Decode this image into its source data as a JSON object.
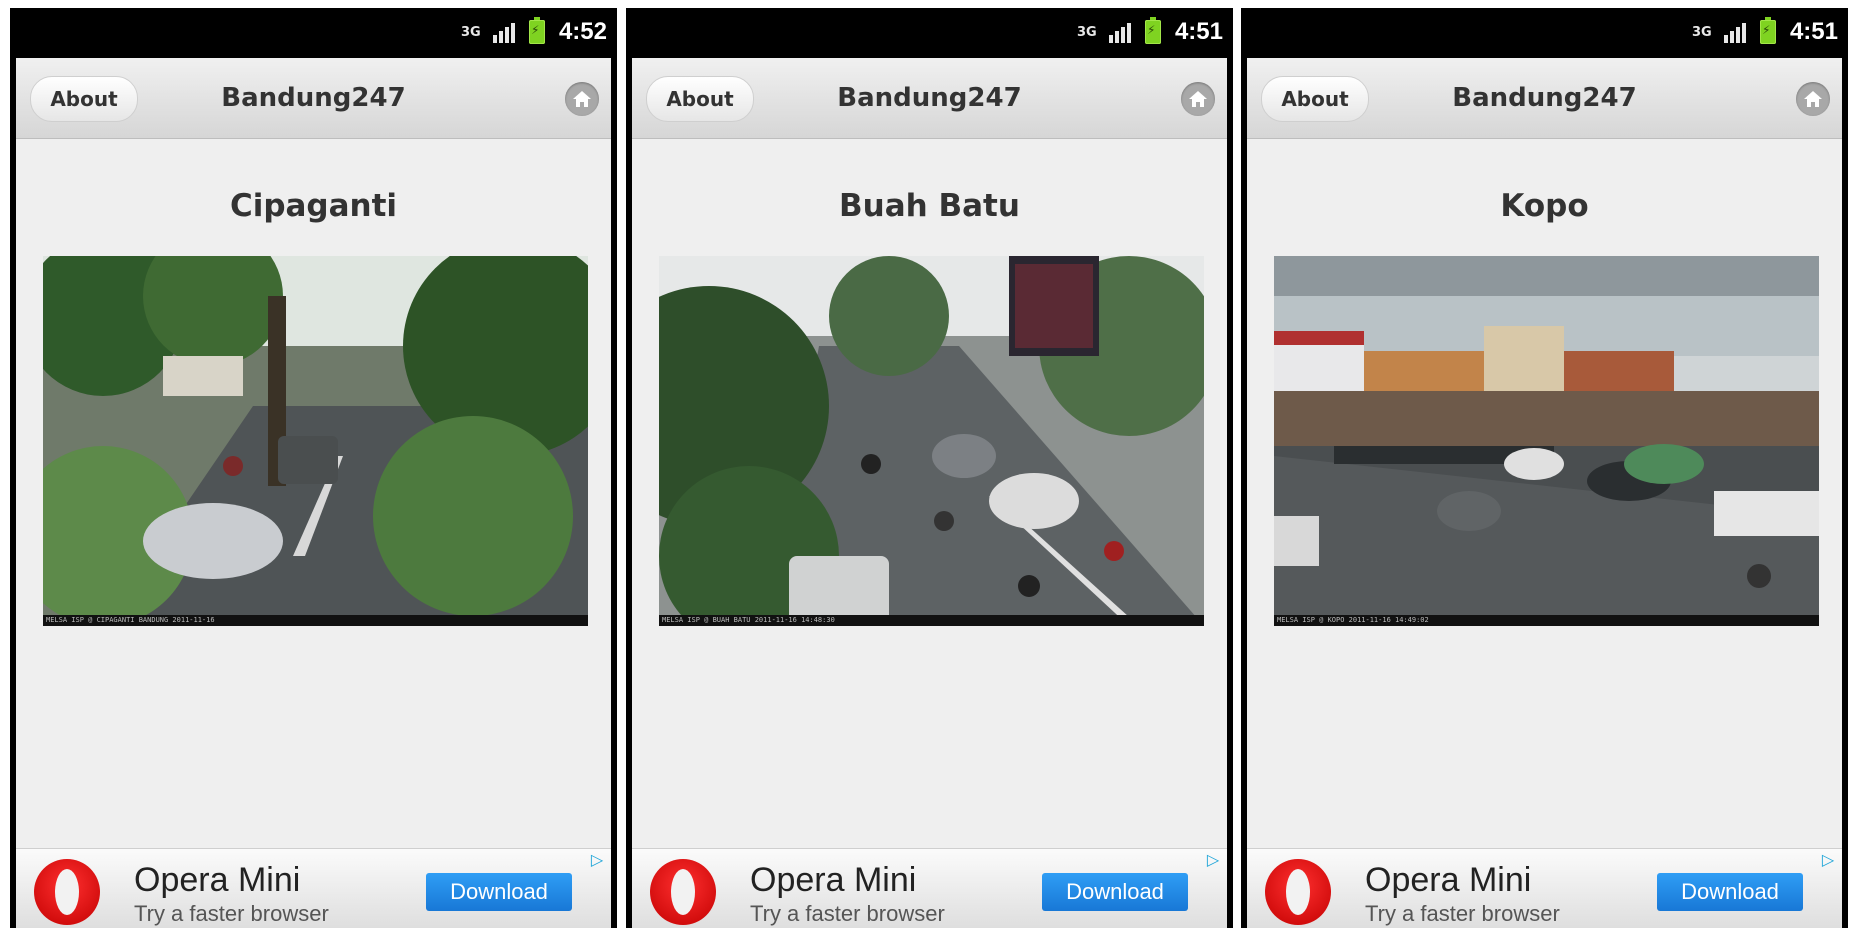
{
  "status_bar": {
    "time_1": "4:52",
    "time_2": "4:51",
    "time_3": "4:51",
    "network_label": "3G"
  },
  "app": {
    "about_label": "About",
    "title": "Bandung247",
    "home_icon": "home-icon"
  },
  "screens": [
    {
      "location": "Cipaganti",
      "camera_caption": "MELSA ISP @ CIPAGANTI BANDUNG 2011-11-16"
    },
    {
      "location": "Buah Batu",
      "camera_caption": "MELSA ISP @ BUAH BATU 2011-11-16 14:48:30"
    },
    {
      "location": "Kopo",
      "camera_caption": "MELSA ISP @ KOPO 2011-11-16 14:49:02"
    }
  ],
  "ad": {
    "brand": "Opera Mini",
    "tagline": "Try a faster browser",
    "cta": "Download",
    "logo_icon": "opera-logo-icon",
    "adchoices_icon": "adchoices-icon"
  },
  "colors": {
    "header_bg": "#dcdcdc",
    "page_bg": "#efefef",
    "download_btn": "#1e88e5",
    "opera_red": "#d80000",
    "battery": "#7fd321"
  }
}
